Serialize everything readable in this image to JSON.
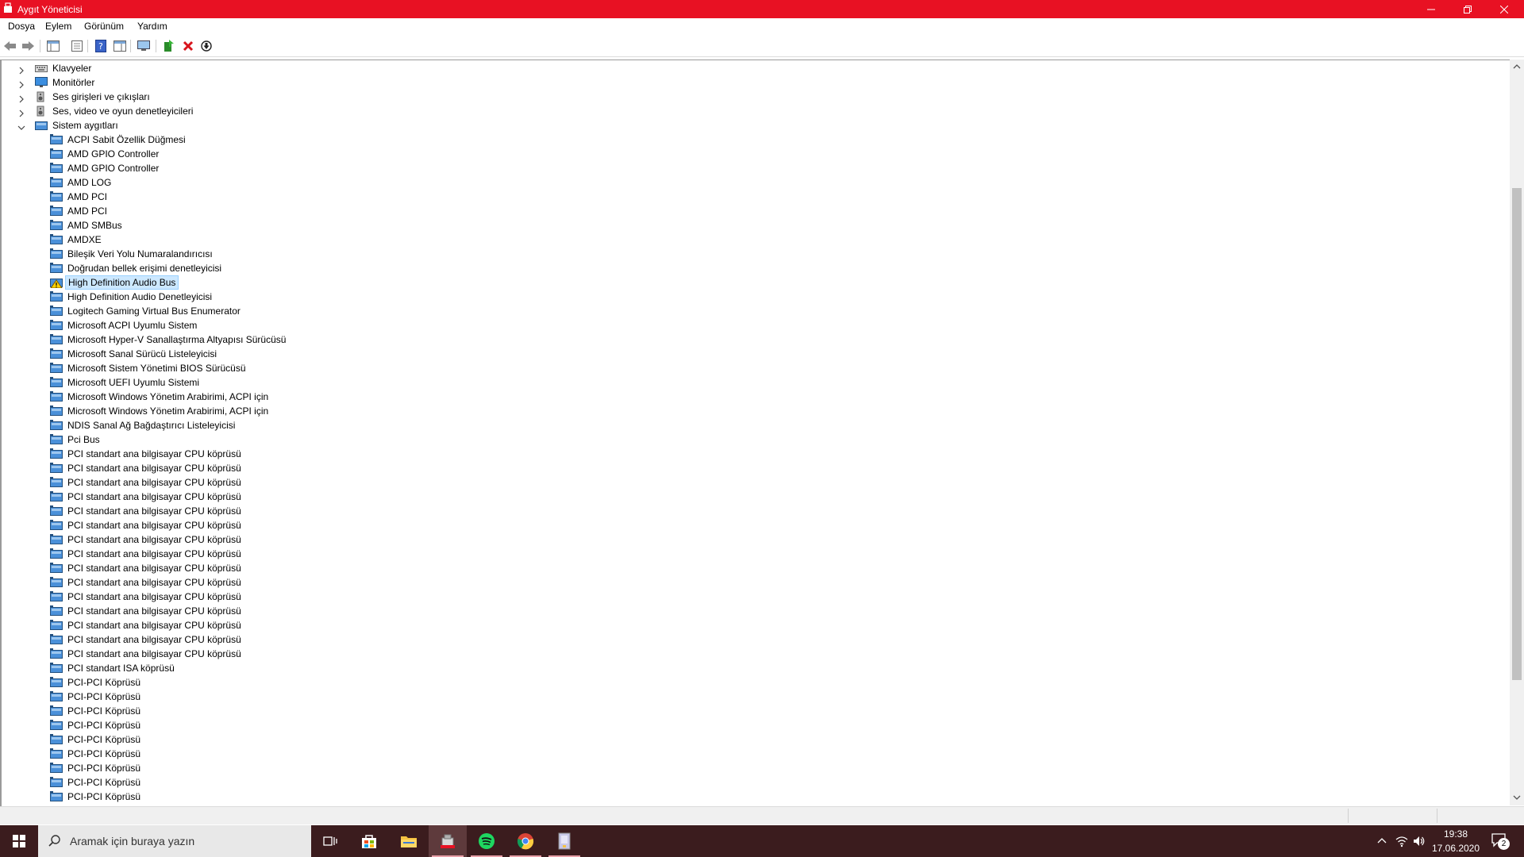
{
  "window": {
    "title": "Aygıt Yöneticisi",
    "accent": "#e81123"
  },
  "menu": [
    "Dosya",
    "Eylem",
    "Görünüm",
    "Yardım"
  ],
  "tree": {
    "categories": [
      {
        "label": "Klavyeler",
        "icon": "keyboard-icon"
      },
      {
        "label": "Monitörler",
        "icon": "monitor-icon"
      },
      {
        "label": "Ses girişleri ve çıkışları",
        "icon": "speaker-icon"
      },
      {
        "label": "Ses, video ve oyun denetleyicileri",
        "icon": "speaker-icon"
      },
      {
        "label": "Sistem aygıtları",
        "icon": "folder-device-icon",
        "expanded": true
      }
    ],
    "devices": [
      "ACPI Sabit Özellik Düğmesi",
      "AMD GPIO Controller",
      "AMD GPIO Controller",
      "AMD LOG",
      "AMD PCI",
      "AMD PCI",
      "AMD SMBus",
      "AMDXE",
      "Bileşik Veri Yolu Numaralandırıcısı",
      "Doğrudan bellek erişimi denetleyicisi",
      "High Definition Audio Bus",
      "High Definition Audio Denetleyicisi",
      "Logitech Gaming Virtual Bus Enumerator",
      "Microsoft ACPI Uyumlu Sistem",
      "Microsoft Hyper-V Sanallaştırma Altyapısı Sürücüsü",
      "Microsoft Sanal Sürücü Listeleyicisi",
      "Microsoft Sistem Yönetimi BIOS Sürücüsü",
      "Microsoft UEFI Uyumlu Sistemi",
      "Microsoft Windows Yönetim Arabirimi, ACPI için",
      "Microsoft Windows Yönetim Arabirimi, ACPI için",
      "NDIS Sanal Ağ Bağdaştırıcı Listeleyicisi",
      "Pci Bus",
      "PCI standart ana bilgisayar CPU köprüsü",
      "PCI standart ana bilgisayar CPU köprüsü",
      "PCI standart ana bilgisayar CPU köprüsü",
      "PCI standart ana bilgisayar CPU köprüsü",
      "PCI standart ana bilgisayar CPU köprüsü",
      "PCI standart ana bilgisayar CPU köprüsü",
      "PCI standart ana bilgisayar CPU köprüsü",
      "PCI standart ana bilgisayar CPU köprüsü",
      "PCI standart ana bilgisayar CPU köprüsü",
      "PCI standart ana bilgisayar CPU köprüsü",
      "PCI standart ana bilgisayar CPU köprüsü",
      "PCI standart ana bilgisayar CPU köprüsü",
      "PCI standart ana bilgisayar CPU köprüsü",
      "PCI standart ana bilgisayar CPU köprüsü",
      "PCI standart ana bilgisayar CPU köprüsü",
      "PCI standart ISA köprüsü",
      "PCI-PCI Köprüsü",
      "PCI-PCI Köprüsü",
      "PCI-PCI Köprüsü",
      "PCI-PCI Köprüsü",
      "PCI-PCI Köprüsü",
      "PCI-PCI Köprüsü",
      "PCI-PCI Köprüsü",
      "PCI-PCI Köprüsü",
      "PCI-PCI Köprüsü"
    ],
    "selected_device": "High Definition Audio Bus",
    "warning_device": "High Definition Audio Bus"
  },
  "taskbar": {
    "search_placeholder": "Aramak için buraya yazın",
    "time": "19:38",
    "date": "17.06.2020",
    "notification_count": "2"
  }
}
